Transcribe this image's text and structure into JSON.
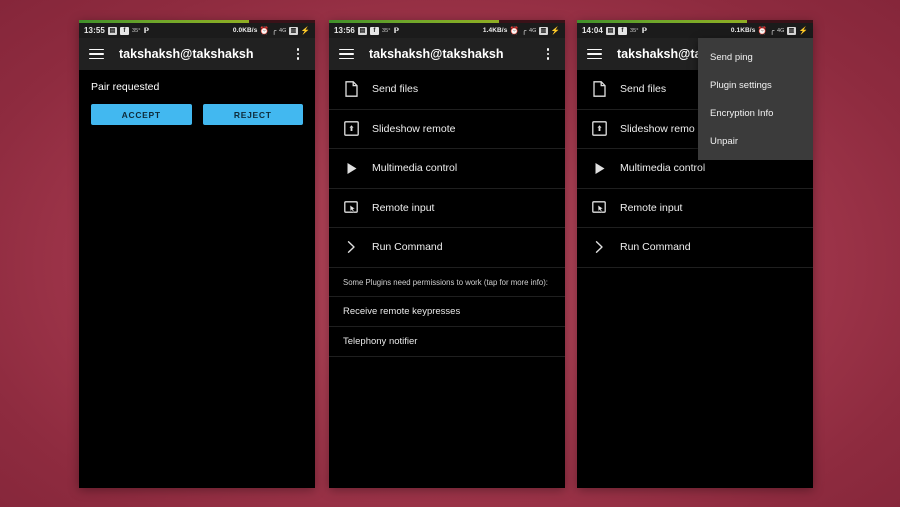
{
  "background": {
    "accent_color": "#b5465c",
    "edge_color": "#85263a"
  },
  "colors": {
    "button_blue": "#42b8f0",
    "appbar_bg": "#212121",
    "screen_bg": "#000000",
    "menu_bg": "#3b3b3b",
    "strip_green": "#6fa62a"
  },
  "phones": [
    {
      "id": "phone-pair-request",
      "status_bar": {
        "time": "13:55",
        "left_icons": [
          "sim-icon",
          "facebook-icon",
          "temperature-icon",
          "parking-icon"
        ],
        "temperature": "35°",
        "network_speed": "0.0KB/s",
        "right_icons": [
          "alarm-icon",
          "signal-icon",
          "4g-icon",
          "sim2-icon",
          "battery-icon"
        ],
        "network_type": "4G"
      },
      "appbar": {
        "menu_icon": "hamburger-icon",
        "title": "takshaksh@takshaksh",
        "overflow_icon": "overflow-menu-icon"
      },
      "pair_request": {
        "message": "Pair requested",
        "accept_label": "ACCEPT",
        "reject_label": "REJECT"
      }
    },
    {
      "id": "phone-plugin-list",
      "status_bar": {
        "time": "13:56",
        "left_icons": [
          "sim-icon",
          "facebook-icon",
          "temperature-icon",
          "parking-icon"
        ],
        "temperature": "35°",
        "network_speed": "1.4KB/s",
        "right_icons": [
          "alarm-icon",
          "signal-icon",
          "4g-icon",
          "sim2-icon",
          "battery-icon"
        ],
        "network_type": "4G"
      },
      "appbar": {
        "menu_icon": "hamburger-icon",
        "title": "takshaksh@takshaksh",
        "overflow_icon": "overflow-menu-icon"
      },
      "plugins": [
        {
          "label": "Send files",
          "icon": "file-document-icon"
        },
        {
          "label": "Slideshow remote",
          "icon": "presentation-icon"
        },
        {
          "label": "Multimedia control",
          "icon": "play-triangle-icon"
        },
        {
          "label": "Remote input",
          "icon": "touchpad-cursor-icon"
        },
        {
          "label": "Run Command",
          "icon": "chevron-right-icon"
        }
      ],
      "permissions": {
        "note": "Some Plugins need permissions to work (tap for more info):",
        "items": [
          {
            "label": "Receive remote keypresses"
          },
          {
            "label": "Telephony notifier"
          }
        ]
      }
    },
    {
      "id": "phone-overflow-menu",
      "status_bar": {
        "time": "14:04",
        "left_icons": [
          "sim-icon",
          "facebook-icon",
          "temperature-icon",
          "parking-icon"
        ],
        "temperature": "35°",
        "network_speed": "0.1KB/s",
        "right_icons": [
          "alarm-icon",
          "signal-icon",
          "4g-icon",
          "sim2-icon",
          "battery-icon"
        ],
        "network_type": "4G"
      },
      "appbar": {
        "menu_icon": "hamburger-icon",
        "title": "takshaksh@ta",
        "overflow_icon": "overflow-menu-icon"
      },
      "plugins": [
        {
          "label": "Send files",
          "icon": "file-document-icon"
        },
        {
          "label": "Slideshow remo",
          "icon": "presentation-icon"
        },
        {
          "label": "Multimedia control",
          "icon": "play-triangle-icon"
        },
        {
          "label": "Remote input",
          "icon": "touchpad-cursor-icon"
        },
        {
          "label": "Run Command",
          "icon": "chevron-right-icon"
        }
      ],
      "dropdown": {
        "items": [
          {
            "label": "Send ping"
          },
          {
            "label": "Plugin settings"
          },
          {
            "label": "Encryption Info"
          },
          {
            "label": "Unpair"
          }
        ]
      }
    }
  ]
}
